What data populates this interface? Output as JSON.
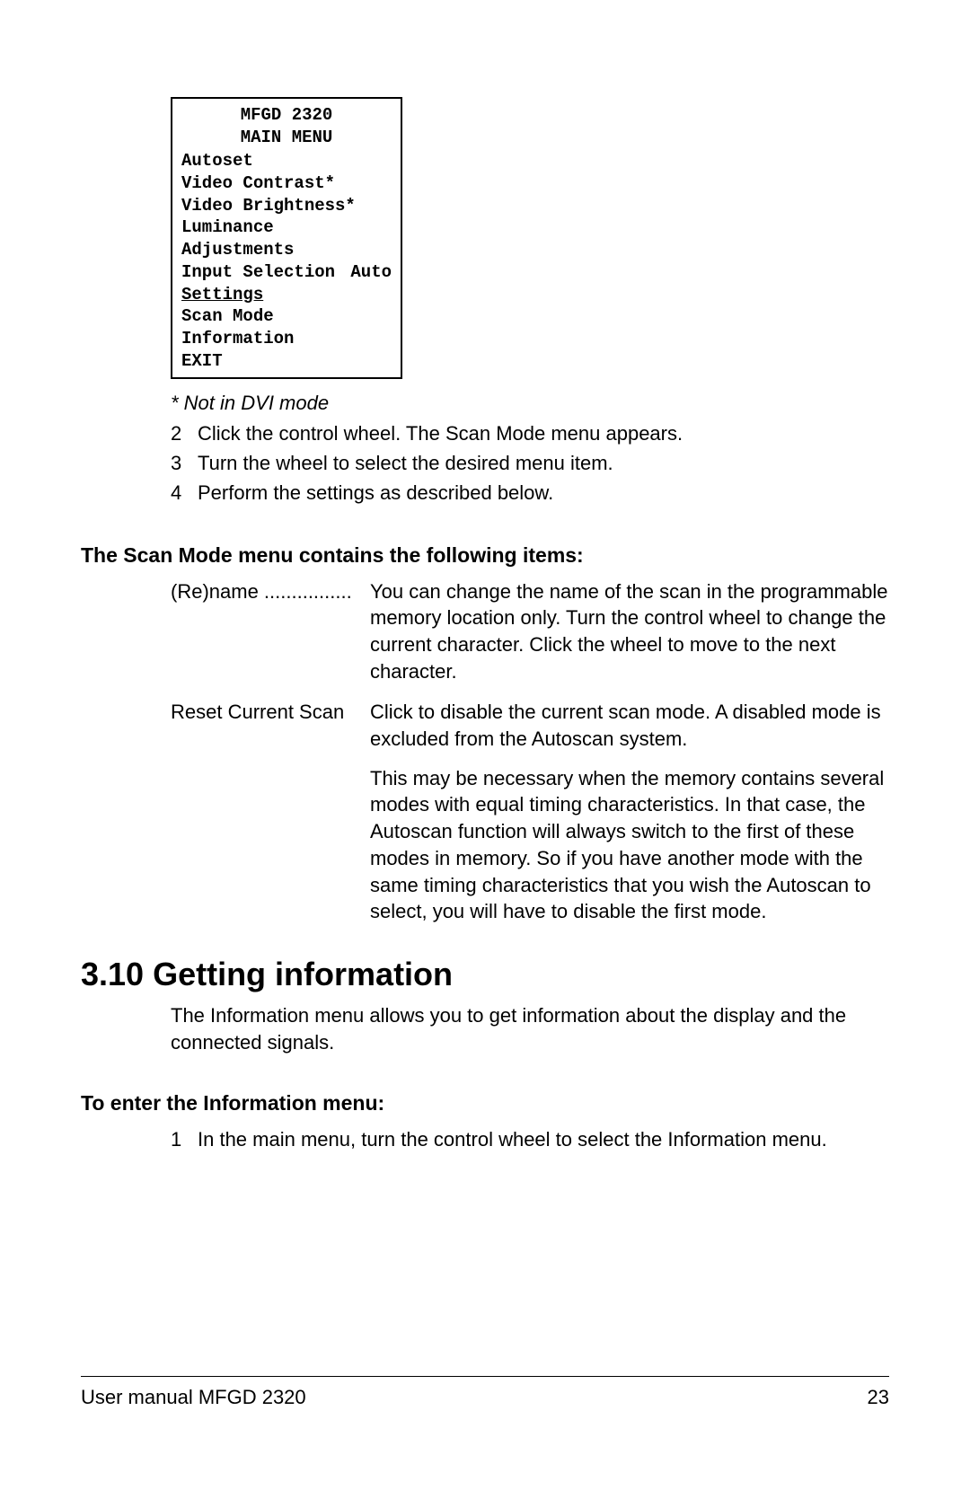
{
  "menu": {
    "title1": "MFGD 2320",
    "title2": "MAIN MENU",
    "items": {
      "i0": "Autoset",
      "i1": "Video Contrast*",
      "i2": "Video Brightness*",
      "i3": "Luminance",
      "i4": "Adjustments",
      "i5_label": "Input Selection",
      "i5_value": "Auto",
      "i6": "Settings",
      "i7": "Scan Mode",
      "i8": "Information",
      "i9": "EXIT"
    }
  },
  "note": "* Not in DVI mode",
  "steps": {
    "s2_num": "2",
    "s2_text": "Click the control wheel. The Scan Mode menu appears.",
    "s3_num": "3",
    "s3_text": "Turn the wheel to select the desired menu item.",
    "s4_num": "4",
    "s4_text": "Perform the settings as described below."
  },
  "sub1": "The Scan Mode menu contains the following items:",
  "defs": {
    "d1_term": "(Re)name ................",
    "d1_desc": "You can change the name of the scan in the programmable memory location only. Turn the control wheel to change the current character. Click the wheel to move to the next character.",
    "d2_term": "Reset Current Scan",
    "d2_desc1": "Click to disable the current scan mode. A disabled mode is excluded from the Autoscan system.",
    "d2_desc2": "This may be necessary when the memory contains several modes with equal timing characteristics. In that case, the Autoscan function will always switch to the first of these modes in memory. So if you have another mode with the same timing characteristics that you wish the Autoscan to select, you will have to disable the first mode."
  },
  "section_heading": "3.10 Getting information",
  "section_body": "The Information menu allows you to get information about the display and the connected signals.",
  "sub2": "To enter the Information menu:",
  "steps2": {
    "s1_num": "1",
    "s1_text": "In the main menu, turn the control wheel to select the Information menu."
  },
  "footer": {
    "left": "User manual MFGD 2320",
    "right": "23"
  }
}
